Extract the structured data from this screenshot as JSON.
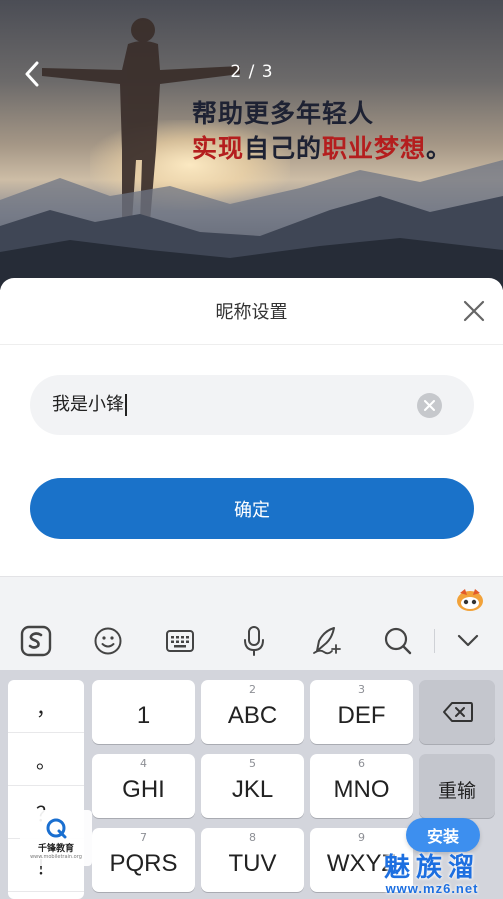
{
  "banner": {
    "pager": "2 / 3",
    "slogan_line1": "帮助更多年轻人",
    "slogan_line2_a": "实现",
    "slogan_line2_b": "自己的",
    "slogan_line2_c": "职业梦想",
    "slogan_line2_d": "。"
  },
  "sheet": {
    "title": "昵称设置",
    "nickname_value": "我是小锋",
    "confirm_label": "确定"
  },
  "keyboard": {
    "toolbar_icons": [
      "sogou-logo-icon",
      "emoji-icon",
      "keyboard-icon",
      "microphone-icon",
      "handwriting-icon",
      "search-icon",
      "collapse-chevron-icon"
    ],
    "punctuation": [
      "，",
      "。",
      "？",
      "！"
    ],
    "keys": [
      {
        "sub": "",
        "main": "1"
      },
      {
        "sub": "2",
        "main": "ABC"
      },
      {
        "sub": "3",
        "main": "DEF"
      },
      {
        "sub": "4",
        "main": "GHI"
      },
      {
        "sub": "5",
        "main": "JKL"
      },
      {
        "sub": "6",
        "main": "MNO"
      },
      {
        "sub": "7",
        "main": "PQRS"
      },
      {
        "sub": "8",
        "main": "TUV"
      },
      {
        "sub": "9",
        "main": "WXYZ"
      }
    ],
    "retype_label": "重输"
  },
  "overlay": {
    "logo_text": "千锋教育",
    "logo_url": "www.mobiletrain.org",
    "install_label": "安装",
    "site_name": "魅族溜",
    "site_url": "www.mz6.net"
  },
  "colors": {
    "accent": "#1a72c9",
    "slogan_red": "#b41e1e",
    "install_blue": "#3d8fef"
  }
}
